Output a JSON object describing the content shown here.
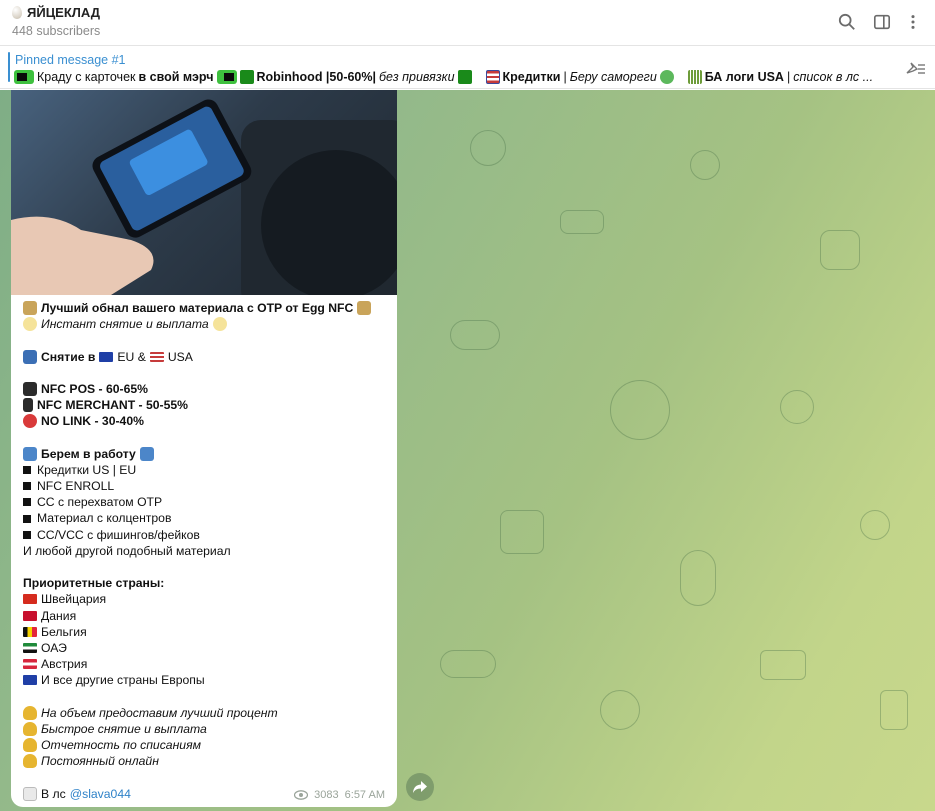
{
  "header": {
    "title": "ЯЙЦЕКЛАД",
    "subscribers": "448 subscribers",
    "icons": [
      "search-icon",
      "sidebar-toggle-icon",
      "more-vertical-icon"
    ]
  },
  "pinned": {
    "title": "Pinned message #1",
    "t1": "Краду с карточек",
    "t2": "в свой мэрч",
    "t3": "Robinhood |50-60%|",
    "t4": "без привязки",
    "t5": "Кредитки",
    "t6": "|",
    "t7": "Беру самореги",
    "t8": "БА логи USA",
    "t9": "|",
    "t10": "список в лс ..."
  },
  "message": {
    "headline": "Лучший обнал вашего материала с OTP от Egg NFC",
    "subline": "Инстант снятие и выплата",
    "withdraw": "Снятие в",
    "eu": "EU &",
    "usa": "USA",
    "nfc_pos": "NFC POS - 60-65%",
    "nfc_merchant": "NFC MERCHANT - 50-55%",
    "no_link": "NO LINK - 30-40%",
    "take_title": "Берем в работу",
    "take_items": [
      "Кредитки US | EU",
      "NFC ENROLL",
      "CC с перехватом OTP",
      "Материал с колцентров",
      "CC/VCC с фишингов/фейков"
    ],
    "any_other": "И любой другой подобный материал",
    "countries_title": "Приоритетные страны:",
    "countries": [
      "Швейцария",
      "Дания",
      "Бельгия",
      "ОАЭ",
      "Австрия",
      "И все другие страны Европы"
    ],
    "perks": [
      "На объем предоставим лучший процент",
      "Быстрое снятие и выплата",
      "Отчетность по списаниям",
      "Постоянный онлайн"
    ],
    "contact_prefix": "В лс",
    "contact_handle": "@slava044",
    "views": "3083",
    "time": "6:57 AM"
  },
  "colors": {
    "accent": "#3a8fd1",
    "chat_bg_left": "#7fae86",
    "chat_bg_right": "#c8d88c"
  }
}
